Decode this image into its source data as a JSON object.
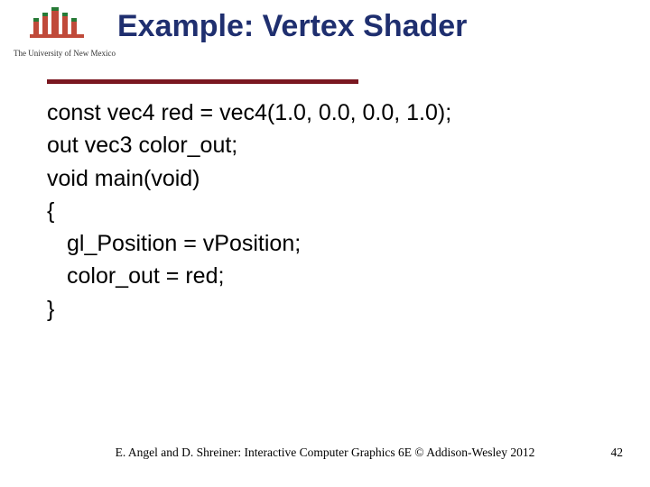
{
  "logo": {
    "caption": "The University of New Mexico"
  },
  "title": "Example: Vertex Shader",
  "code": {
    "l1": "const vec4 red = vec4(1.0, 0.0, 0.0, 1.0);",
    "l2": "out vec3 color_out;",
    "l3": "void main(void)",
    "l4": "{",
    "l5": "gl_Position = vPosition;",
    "l6": "color_out = red;",
    "l7": "}"
  },
  "footer": "E. Angel and D. Shreiner: Interactive Computer Graphics 6E © Addison-Wesley 2012",
  "page": "42"
}
